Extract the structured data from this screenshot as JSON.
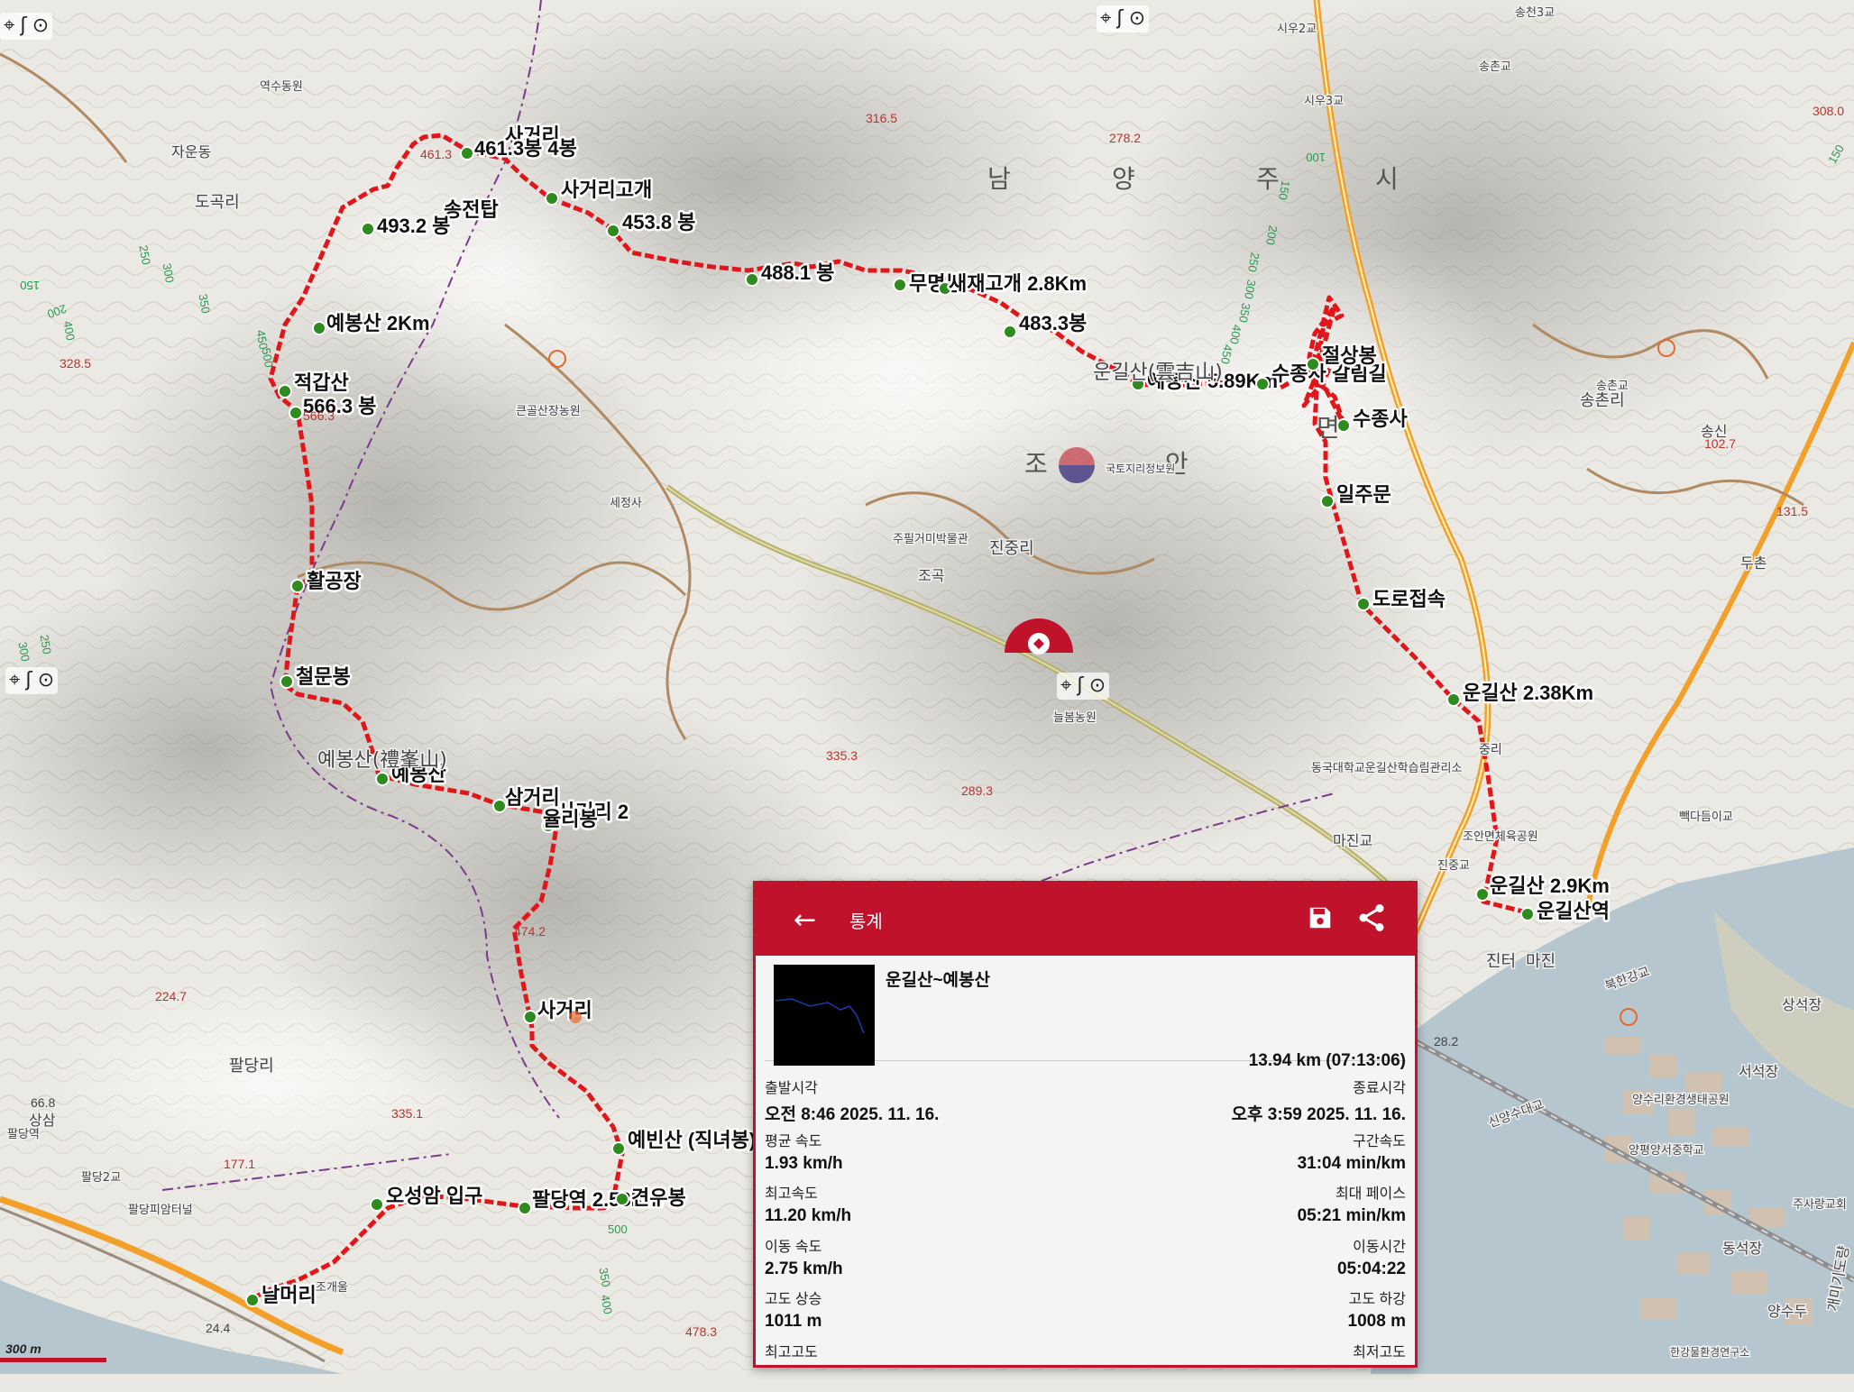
{
  "map": {
    "colors": {
      "route": "#e0161b",
      "marker": "#2e8b1e",
      "accent": "#c0122b"
    },
    "waypoints": [
      {
        "id": "w1",
        "label": "사거리"
      },
      {
        "id": "w2",
        "label": "461.3봉 4봉"
      },
      {
        "id": "w3",
        "label": "사거리고개"
      },
      {
        "id": "w4",
        "label": "송전탑"
      },
      {
        "id": "w5",
        "label": "493.2 봉"
      },
      {
        "id": "w6",
        "label": "453.8 봉"
      },
      {
        "id": "w7",
        "label": "488.1 봉"
      },
      {
        "id": "w8",
        "label": "무명봉"
      },
      {
        "id": "w9",
        "label": "새재고개 2.8Km"
      },
      {
        "id": "w10",
        "label": "483.3봉"
      },
      {
        "id": "w11",
        "label": "예봉산 2Km"
      },
      {
        "id": "w12",
        "label": "적갑산"
      },
      {
        "id": "w13",
        "label": "566.3 봉"
      },
      {
        "id": "w14",
        "label": "예봉산 5.89Km"
      },
      {
        "id": "w15",
        "label": "수종사 갈림길"
      },
      {
        "id": "w16",
        "label": "절상봉"
      },
      {
        "id": "w17",
        "label": "수종사"
      },
      {
        "id": "w18",
        "label": "일주문"
      },
      {
        "id": "w19",
        "label": "활공장"
      },
      {
        "id": "w20",
        "label": "도로접속"
      },
      {
        "id": "w21",
        "label": "철문봉"
      },
      {
        "id": "w22",
        "label": "운길산 2.38Km"
      },
      {
        "id": "w23",
        "label": "예봉산"
      },
      {
        "id": "w24",
        "label": "삼거리"
      },
      {
        "id": "w25",
        "label": "사거리 2"
      },
      {
        "id": "w26",
        "label": "율리봉"
      },
      {
        "id": "w27",
        "label": "운길산 2.9Km"
      },
      {
        "id": "w28",
        "label": "운길산역"
      },
      {
        "id": "w29",
        "label": "사거리"
      },
      {
        "id": "w30",
        "label": "예빈산 (직녀봉)"
      },
      {
        "id": "w31",
        "label": "오성암 입구"
      },
      {
        "id": "w32",
        "label": "팔당역 2.53Km"
      },
      {
        "id": "w33",
        "label": "견우봉"
      },
      {
        "id": "w34",
        "label": "날머리"
      }
    ],
    "places": [
      {
        "id": "p1",
        "text": "남"
      },
      {
        "id": "p2",
        "text": "양"
      },
      {
        "id": "p3",
        "text": "주"
      },
      {
        "id": "p4",
        "text": "시"
      },
      {
        "id": "p5",
        "text": "조"
      },
      {
        "id": "p6",
        "text": "안"
      },
      {
        "id": "p7",
        "text": "면"
      },
      {
        "id": "p8",
        "text": "진중리"
      },
      {
        "id": "p9",
        "text": "송촌리"
      },
      {
        "id": "p10",
        "text": "도곡리"
      },
      {
        "id": "p11",
        "text": "자운동"
      },
      {
        "id": "p12",
        "text": "팔당리"
      },
      {
        "id": "p13",
        "text": "운길산(雲吉山)"
      },
      {
        "id": "p14",
        "text": "예봉산(禮峯山)"
      },
      {
        "id": "p15",
        "text": "마진교"
      },
      {
        "id": "p16",
        "text": "진중교"
      },
      {
        "id": "p17",
        "text": "조곡"
      },
      {
        "id": "p18",
        "text": "세정사"
      },
      {
        "id": "p19",
        "text": "주필거미박물관"
      },
      {
        "id": "p20",
        "text": "늘봄농원"
      },
      {
        "id": "p21",
        "text": "두촌"
      },
      {
        "id": "p22",
        "text": "송신"
      },
      {
        "id": "p23",
        "text": "서석장"
      },
      {
        "id": "p24",
        "text": "상석장"
      },
      {
        "id": "p25",
        "text": "팔당피암터널"
      },
      {
        "id": "p26",
        "text": "팔당2교"
      },
      {
        "id": "p27",
        "text": "팔당역"
      },
      {
        "id": "p28",
        "text": "조개울"
      },
      {
        "id": "p29",
        "text": "북한강교"
      },
      {
        "id": "p30",
        "text": "신양수대교"
      },
      {
        "id": "p31",
        "text": "양수리환경생태공원"
      },
      {
        "id": "p32",
        "text": "송천3교"
      },
      {
        "id": "p33",
        "text": "송촌교"
      },
      {
        "id": "p34",
        "text": "시우2교"
      },
      {
        "id": "p35",
        "text": "시우3교"
      },
      {
        "id": "p36",
        "text": "국토지리정보원"
      },
      {
        "id": "p37",
        "text": "큰골산장농원"
      },
      {
        "id": "p38",
        "text": "동국대학교운길산학습림관리소"
      },
      {
        "id": "p39",
        "text": "역수동원"
      },
      {
        "id": "p40",
        "text": "빽다듬이교"
      },
      {
        "id": "p41",
        "text": "조안면체육공원"
      },
      {
        "id": "p42",
        "text": "중리"
      },
      {
        "id": "p43",
        "text": "송촌교"
      },
      {
        "id": "p44",
        "text": "진터"
      },
      {
        "id": "p45",
        "text": "마진"
      },
      {
        "id": "p46",
        "text": "양평양서중학교"
      },
      {
        "id": "p47",
        "text": "개미기도량"
      },
      {
        "id": "p48",
        "text": "한강물환경연구소"
      },
      {
        "id": "p49",
        "text": "동석장"
      },
      {
        "id": "p50",
        "text": "주사랑교회"
      },
      {
        "id": "p51",
        "text": "상삼"
      },
      {
        "id": "p52",
        "text": "양수두"
      }
    ],
    "elevations": [
      {
        "id": "e1",
        "text": "316.5"
      },
      {
        "id": "e2",
        "text": "278.2"
      },
      {
        "id": "e3",
        "text": "308.0"
      },
      {
        "id": "e4",
        "text": "461.3"
      },
      {
        "id": "e5",
        "text": "328.5"
      },
      {
        "id": "e6",
        "text": "566.3"
      },
      {
        "id": "e7",
        "text": "102.7"
      },
      {
        "id": "e8",
        "text": "131.5"
      },
      {
        "id": "e9",
        "text": "335.3"
      },
      {
        "id": "e10",
        "text": "289.3"
      },
      {
        "id": "e11",
        "text": "474.2"
      },
      {
        "id": "e12",
        "text": "224.7"
      },
      {
        "id": "e13",
        "text": "335.1"
      },
      {
        "id": "e14",
        "text": "177.1"
      },
      {
        "id": "e15",
        "text": "66.8"
      },
      {
        "id": "e16",
        "text": "478.3"
      },
      {
        "id": "e17",
        "text": "28.2"
      },
      {
        "id": "e18",
        "text": "24.4"
      }
    ],
    "contours": [
      {
        "id": "c1",
        "text": "150"
      },
      {
        "id": "c2",
        "text": "200"
      },
      {
        "id": "c3",
        "text": "250"
      },
      {
        "id": "c4",
        "text": "300"
      },
      {
        "id": "c5",
        "text": "350"
      },
      {
        "id": "c6",
        "text": "400"
      },
      {
        "id": "c7",
        "text": "450"
      },
      {
        "id": "c8",
        "text": "500"
      },
      {
        "id": "c9",
        "text": "100"
      },
      {
        "id": "c10",
        "text": "150"
      },
      {
        "id": "c11",
        "text": "200"
      },
      {
        "id": "c12",
        "text": "250"
      },
      {
        "id": "c13",
        "text": "300"
      },
      {
        "id": "c14",
        "text": "350"
      },
      {
        "id": "c15",
        "text": "400"
      },
      {
        "id": "c16",
        "text": "450"
      },
      {
        "id": "c17",
        "text": "500"
      },
      {
        "id": "c18",
        "text": "350"
      },
      {
        "id": "c19",
        "text": "400"
      },
      {
        "id": "c20",
        "text": "150"
      },
      {
        "id": "c21",
        "text": "300"
      },
      {
        "id": "c22",
        "text": "250"
      }
    ],
    "controls": {
      "locate_icon": "crosshair-icon",
      "route_icon": "route-icon",
      "layer_icon": "layer-icon",
      "locate": "⌖",
      "route": "ʃ",
      "layer": "⊙"
    },
    "scale_label": "300 m"
  },
  "stats_panel": {
    "title": "통계",
    "back_icon": "arrow-left-icon",
    "back_glyph": "←",
    "save_icon": "save-icon",
    "share_icon": "share-icon",
    "track_name": "운길산~예봉산",
    "distance_time": "13.94 km (07:13:06)",
    "rows": [
      {
        "left_label": "출발시각",
        "left_value": "오전 8:46 2025. 11. 16.",
        "right_label": "종료시각",
        "right_value": "오후 3:59 2025. 11. 16."
      },
      {
        "left_label": "평균 속도",
        "left_value": "1.93 km/h",
        "right_label": "구간속도",
        "right_value": "31:04 min/km"
      },
      {
        "left_label": "최고속도",
        "left_value": "11.20 km/h",
        "right_label": "최대 페이스",
        "right_value": "05:21 min/km"
      },
      {
        "left_label": "이동 속도",
        "left_value": "2.75 km/h",
        "right_label": "이동시간",
        "right_value": "05:04:22"
      },
      {
        "left_label": "고도 상승",
        "left_value": "1011 m",
        "right_label": "고도 하강",
        "right_value": "1008 m"
      },
      {
        "left_label": "최고고도",
        "left_value": "",
        "right_label": "최저고도",
        "right_value": ""
      }
    ]
  }
}
